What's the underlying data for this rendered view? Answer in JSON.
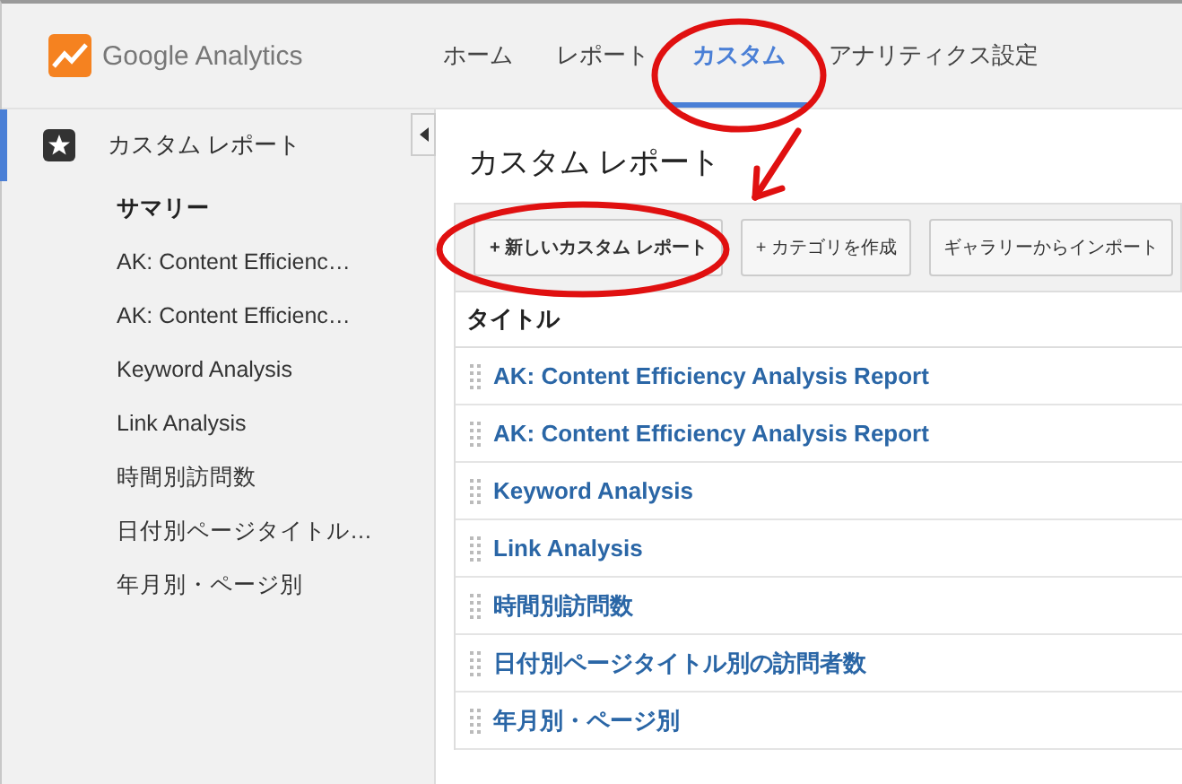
{
  "header": {
    "logo": "Google Analytics",
    "nav": [
      {
        "label": "ホーム",
        "selected": false
      },
      {
        "label": "レポート",
        "selected": false
      },
      {
        "label": "カスタム",
        "selected": true
      },
      {
        "label": "アナリティクス設定",
        "selected": false
      }
    ]
  },
  "sidebar": {
    "section": "カスタム レポート",
    "items": [
      {
        "label": "サマリー",
        "selected": true
      },
      {
        "label": "AK: Content Efficienc…",
        "selected": false
      },
      {
        "label": "AK: Content Efficienc…",
        "selected": false
      },
      {
        "label": "Keyword Analysis",
        "selected": false
      },
      {
        "label": "Link Analysis",
        "selected": false
      },
      {
        "label": "時間別訪問数",
        "selected": false
      },
      {
        "label": "日付別ページタイトル…",
        "selected": false
      },
      {
        "label": "年月別・ページ別",
        "selected": false
      }
    ]
  },
  "main": {
    "title": "カスタム レポート",
    "buttons": [
      "+ 新しいカスタム レポート",
      "+ カテゴリを作成",
      "ギャラリーからインポート"
    ],
    "table": {
      "columns": [
        "タイトル"
      ],
      "rows": [
        "AK: Content Efficiency Analysis Report",
        "AK: Content Efficiency Analysis Report",
        "Keyword Analysis",
        "Link Analysis",
        "時間別訪問数",
        "日付別ページタイトル別の訪問者数",
        "年月別・ページ別"
      ]
    }
  },
  "annotations": [
    {
      "kind": "ellipse"
    },
    {
      "kind": "ellipse"
    },
    {
      "kind": "arrow"
    }
  ]
}
